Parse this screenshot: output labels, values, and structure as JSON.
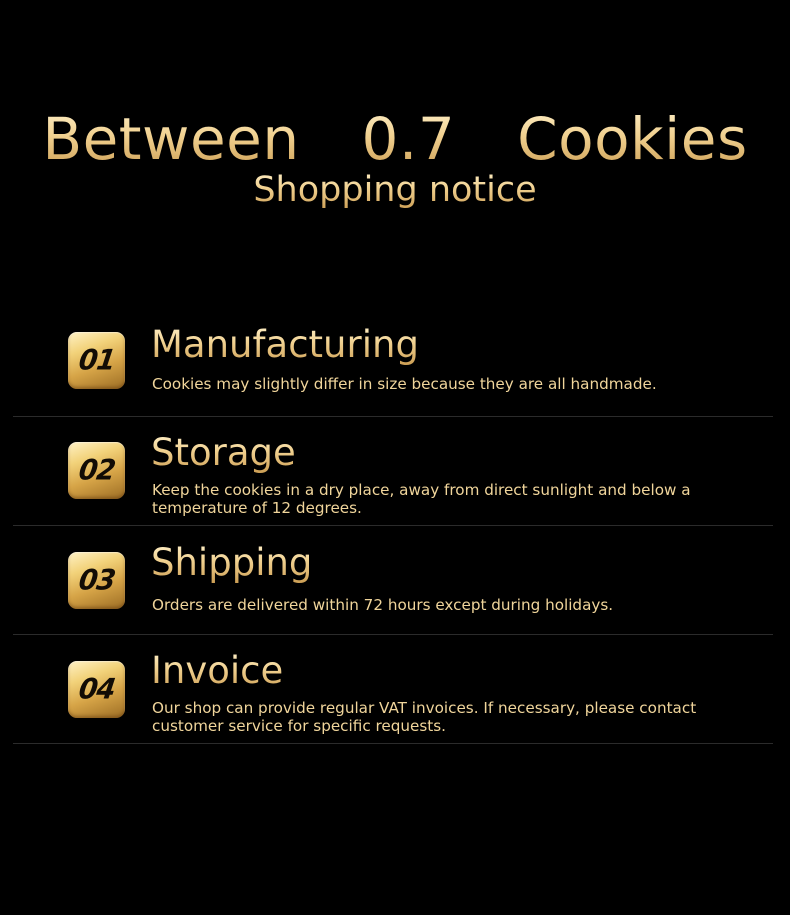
{
  "header": {
    "title": "Between  0.7  Cookies",
    "subtitle": "Shopping notice"
  },
  "colors": {
    "background": "#000000",
    "gold_light": "#fff3cf",
    "gold": "#f1d190",
    "gold_dark": "#c99a4f",
    "badge_text": "#120c05",
    "divider": "#2b2b2b"
  },
  "notices": [
    {
      "number": "01",
      "title": "Manufacturing",
      "description": "Cookies may slightly differ in size because they are all handmade."
    },
    {
      "number": "02",
      "title": "Storage",
      "description": "Keep the cookies in a dry place, away from direct sunlight and below a temperature of 12 degrees."
    },
    {
      "number": "03",
      "title": "Shipping",
      "description": "Orders are delivered within 72 hours except during holidays."
    },
    {
      "number": "04",
      "title": "Invoice",
      "description": "Our shop can provide regular VAT invoices. If necessary, please contact customer service for specific requests."
    }
  ]
}
